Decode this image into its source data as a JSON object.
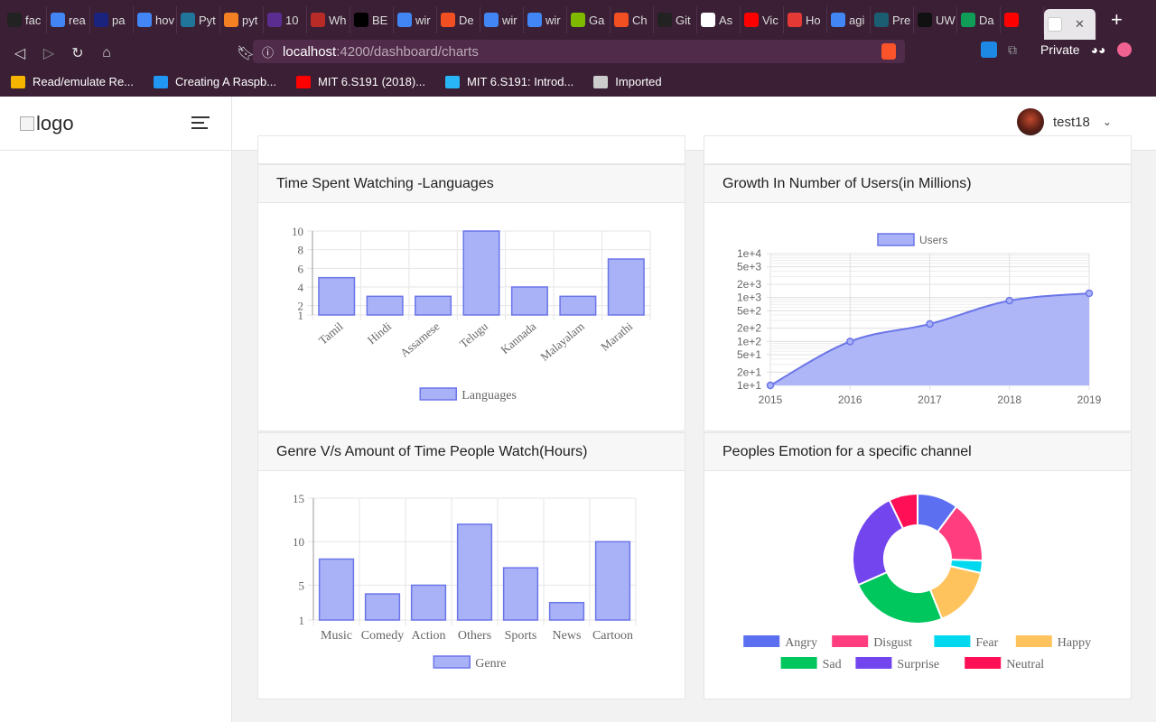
{
  "browser": {
    "tabs": [
      {
        "label": "fac",
        "color": "#222222"
      },
      {
        "label": "rea",
        "color": "#4285f4"
      },
      {
        "label": "pa",
        "color": "#1a237e"
      },
      {
        "label": "hov",
        "color": "#4285f4"
      },
      {
        "label": "Pyt",
        "color": "#21759b"
      },
      {
        "label": "pyt",
        "color": "#f48024"
      },
      {
        "label": "10",
        "color": "#5c2d91"
      },
      {
        "label": "Wh",
        "color": "#b92b27"
      },
      {
        "label": "BE",
        "color": "#000000"
      },
      {
        "label": "wir",
        "color": "#4285f4"
      },
      {
        "label": "De",
        "color": "#f25022"
      },
      {
        "label": "wir",
        "color": "#4285f4"
      },
      {
        "label": "wir",
        "color": "#4285f4"
      },
      {
        "label": "Ga",
        "color": "#7fba00"
      },
      {
        "label": "Ch",
        "color": "#f25022"
      },
      {
        "label": "Git",
        "color": "#222222"
      },
      {
        "label": "As",
        "color": "#ffffff"
      },
      {
        "label": "Vic",
        "color": "#ff0000"
      },
      {
        "label": "Ho",
        "color": "#e53935"
      },
      {
        "label": "agi",
        "color": "#4285f4"
      },
      {
        "label": "Pre",
        "color": "#1b5e72"
      },
      {
        "label": "UW",
        "color": "#111111"
      },
      {
        "label": "Da",
        "color": "#0f9d58"
      },
      {
        "label": "",
        "color": "#ff0000"
      }
    ],
    "active_tab_label": "",
    "url_host": "localhost",
    "url_path": ":4200/dashboard/charts",
    "private_label": "Private",
    "bookmarks": [
      {
        "label": "Read/emulate Re...",
        "color": "#f4b400"
      },
      {
        "label": "Creating A Raspb...",
        "color": "#2196f3"
      },
      {
        "label": "MIT 6.S191 (2018)...",
        "color": "#ff0000"
      },
      {
        "label": "MIT 6.S191: Introd...",
        "color": "#29b6f6"
      },
      {
        "label": "Imported",
        "color": "#cccccc"
      }
    ]
  },
  "header": {
    "logo_alt": "logo",
    "username": "test18"
  },
  "cards": {
    "languages": {
      "title": "Time Spent Watching -Languages"
    },
    "growth": {
      "title": "Growth In Number of Users(in Millions)"
    },
    "genre": {
      "title": "Genre V/s Amount of Time People Watch(Hours)"
    },
    "emotion": {
      "title": "Peoples Emotion for a specific channel"
    }
  },
  "colors": {
    "bar_fill": "#aab2f7",
    "bar_stroke": "#6b75e8",
    "grid": "#e6e6e6",
    "axis_text": "#666666"
  },
  "chart_data": [
    {
      "type": "bar",
      "categories": [
        "Tamil",
        "Hindi",
        "Assamese",
        "Telugu",
        "Kannada",
        "Malayalam",
        "Marathi"
      ],
      "series": [
        {
          "name": "Languages",
          "values": [
            5,
            3,
            3,
            10,
            4,
            3,
            7
          ]
        }
      ],
      "yticks": [
        "10",
        "8",
        "6",
        "4",
        "2",
        "1"
      ],
      "ylim": [
        1,
        10
      ],
      "legend": "bottom",
      "grid": true
    },
    {
      "type": "area",
      "x": [
        "2015",
        "2016",
        "2017",
        "2018",
        "2019"
      ],
      "series": [
        {
          "name": "Users",
          "values": [
            10,
            100,
            250,
            850,
            1250
          ]
        }
      ],
      "yscale": "log",
      "yticks": [
        "1e+4",
        "5e+3",
        "2e+3",
        "1e+3",
        "5e+2",
        "2e+2",
        "1e+2",
        "5e+1",
        "2e+1",
        "1e+1"
      ],
      "ylim": [
        10,
        10000
      ],
      "legend": "top",
      "grid": true
    },
    {
      "type": "bar",
      "categories": [
        "Music",
        "Comedy",
        "Action",
        "Others",
        "Sports",
        "News",
        "Cartoon"
      ],
      "series": [
        {
          "name": "Genre",
          "values": [
            8,
            4,
            5,
            12,
            7,
            3,
            10
          ]
        }
      ],
      "yticks": [
        "15",
        "10",
        "5",
        "1"
      ],
      "ylim": [
        1,
        15
      ],
      "legend": "bottom",
      "grid": true
    },
    {
      "type": "pie",
      "donut": true,
      "labels": [
        "Angry",
        "Disgust",
        "Fear",
        "Happy",
        "Sad",
        "Surprise",
        "Neutral"
      ],
      "values": [
        10,
        15,
        3,
        15,
        24,
        24,
        7
      ],
      "colors": [
        "#5b6ff0",
        "#ff3d7f",
        "#00d8f0",
        "#ffc35e",
        "#00c65e",
        "#7245ee",
        "#ff0f55"
      ],
      "legend": "bottom"
    }
  ]
}
